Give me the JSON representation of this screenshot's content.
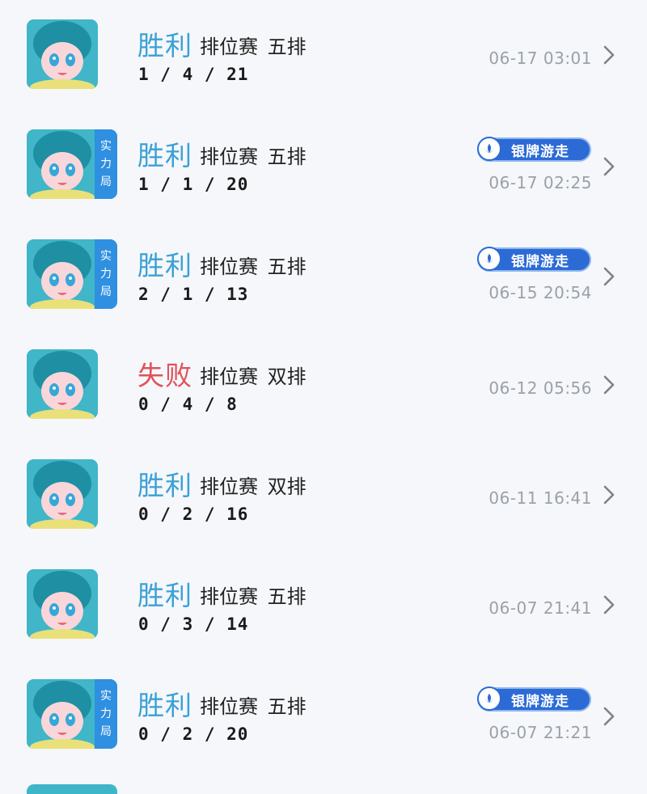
{
  "matches": [
    {
      "result": "胜利",
      "outcome": "win",
      "mode": "排位赛 五排",
      "kda": "1 / 4 / 21",
      "time": "06-17 03:01",
      "rank_badge": false,
      "tag": null
    },
    {
      "result": "胜利",
      "outcome": "win",
      "mode": "排位赛 五排",
      "kda": "1 / 1 / 20",
      "time": "06-17 02:25",
      "rank_badge": true,
      "tag": "银牌游走"
    },
    {
      "result": "胜利",
      "outcome": "win",
      "mode": "排位赛 五排",
      "kda": "2 / 1 / 13",
      "time": "06-15 20:54",
      "rank_badge": true,
      "tag": "银牌游走"
    },
    {
      "result": "失败",
      "outcome": "loss",
      "mode": "排位赛 双排",
      "kda": "0 / 4 / 8",
      "time": "06-12 05:56",
      "rank_badge": false,
      "tag": null
    },
    {
      "result": "胜利",
      "outcome": "win",
      "mode": "排位赛 双排",
      "kda": "0 / 2 / 16",
      "time": "06-11 16:41",
      "rank_badge": false,
      "tag": null
    },
    {
      "result": "胜利",
      "outcome": "win",
      "mode": "排位赛 五排",
      "kda": "0 / 3 / 14",
      "time": "06-07 21:41",
      "rank_badge": false,
      "tag": null
    },
    {
      "result": "胜利",
      "outcome": "win",
      "mode": "排位赛 五排",
      "kda": "0 / 2 / 20",
      "time": "06-07 21:21",
      "rank_badge": true,
      "tag": "银牌游走"
    }
  ],
  "rank_badge_chars": [
    "实",
    "力",
    "局"
  ],
  "colors": {
    "win": "#3aa1d6",
    "loss": "#e0525a",
    "tag": "#2c6bd6",
    "rank_strip": "#2f8fe0"
  },
  "icons": {
    "avatar": "hero-portrait-icon",
    "chevron": "chevron-right-icon",
    "tag": "support-role-icon"
  }
}
